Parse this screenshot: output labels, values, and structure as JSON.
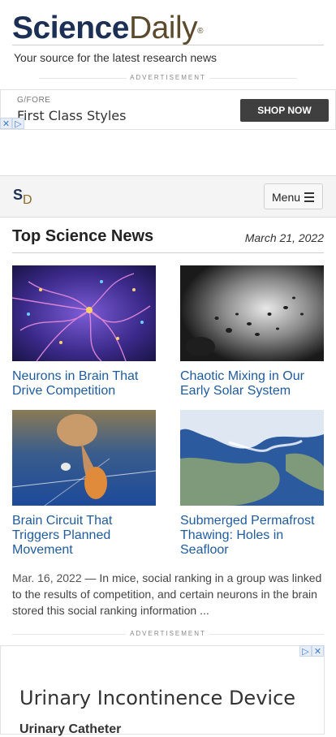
{
  "header": {
    "logo_science": "Science",
    "logo_daily": "Daily",
    "logo_mark": "®",
    "tagline": "Your source for the latest research news"
  },
  "ads": {
    "label": "ADVERTISEMENT",
    "top": {
      "brand": "G/FORE",
      "headline": "First Class Styles",
      "cta": "SHOP NOW"
    },
    "bottom": {
      "headline": "Urinary Incontinence Device",
      "sub": "Urinary Catheter"
    }
  },
  "navbar": {
    "logo_s": "S",
    "logo_d": "D",
    "menu_label": "Menu"
  },
  "section": {
    "title": "Top Science News",
    "date": "March 21, 2022"
  },
  "stories": [
    {
      "title": "Neurons in Brain That Drive Competition",
      "image": "neurons-image"
    },
    {
      "title": "Chaotic Mixing in Our Early Solar System",
      "image": "asteroids-image"
    },
    {
      "title": "Brain Circuit That Triggers Planned Movement",
      "image": "runner-image"
    },
    {
      "title": "Submerged Permafrost Thawing: Holes in Seafloor",
      "image": "arctic-map-image"
    }
  ],
  "summary": {
    "date": "Mar. 16, 2022",
    "text": "— In mice, social ranking in a group was linked to the results of competition, and certain neurons in the brain stored this social ranking information ..."
  }
}
